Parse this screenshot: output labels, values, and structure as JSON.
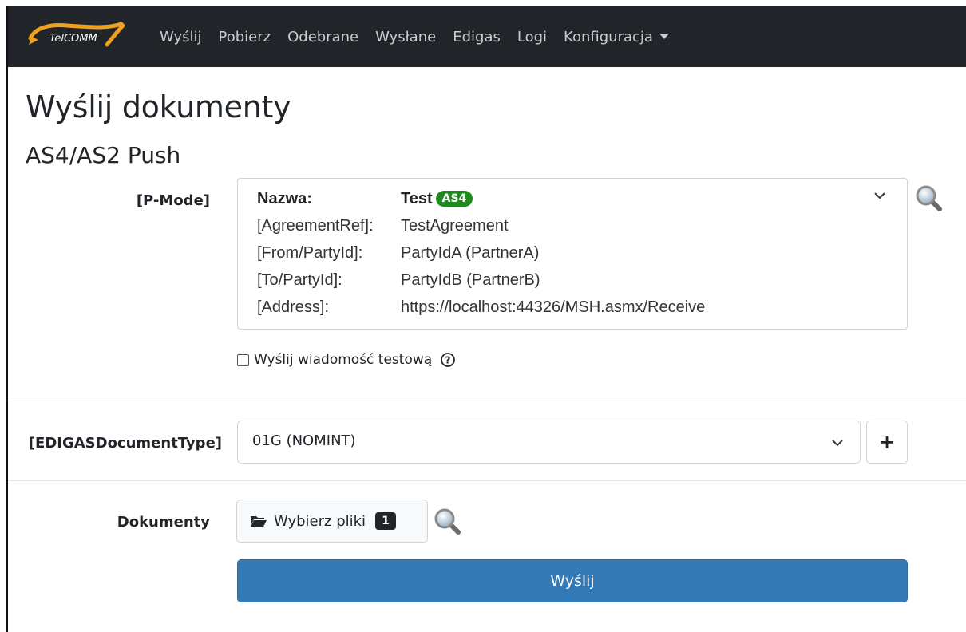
{
  "nav": {
    "brand": "TelCOMM",
    "items": [
      {
        "label": "Wyślij"
      },
      {
        "label": "Pobierz"
      },
      {
        "label": "Odebrane"
      },
      {
        "label": "Wysłane"
      },
      {
        "label": "Edigas"
      },
      {
        "label": "Logi"
      },
      {
        "label": "Konfiguracja"
      }
    ]
  },
  "page": {
    "title": "Wyślij dokumenty",
    "subtitle": "AS4/AS2 Push"
  },
  "pmode": {
    "label": "[P-Mode]",
    "rows": [
      {
        "key": "Nazwa:",
        "value": "Test",
        "badge": "AS4"
      },
      {
        "key": "[AgreementRef]:",
        "value": "TestAgreement"
      },
      {
        "key": "[From/PartyId]:",
        "value": "PartyIdA (PartnerA)"
      },
      {
        "key": "[To/PartyId]:",
        "value": "PartyIdB (PartnerB)"
      },
      {
        "key": "[Address]:",
        "value": "https://localhost:44326/MSH.asmx/Receive"
      }
    ]
  },
  "test_message": {
    "label": "Wyślij wiadomość testową",
    "checked": false
  },
  "document_type": {
    "label": "[EDIGASDocumentType]",
    "selected": "01G (NOMINT)",
    "add_label": "+"
  },
  "documents": {
    "label": "Dokumenty",
    "button_label": "Wybierz pliki",
    "count": "1"
  },
  "submit": {
    "label": "Wyślij"
  },
  "colors": {
    "navbar": "#212529",
    "badge_as4": "#1e8a1e",
    "primary": "#337ab7"
  }
}
